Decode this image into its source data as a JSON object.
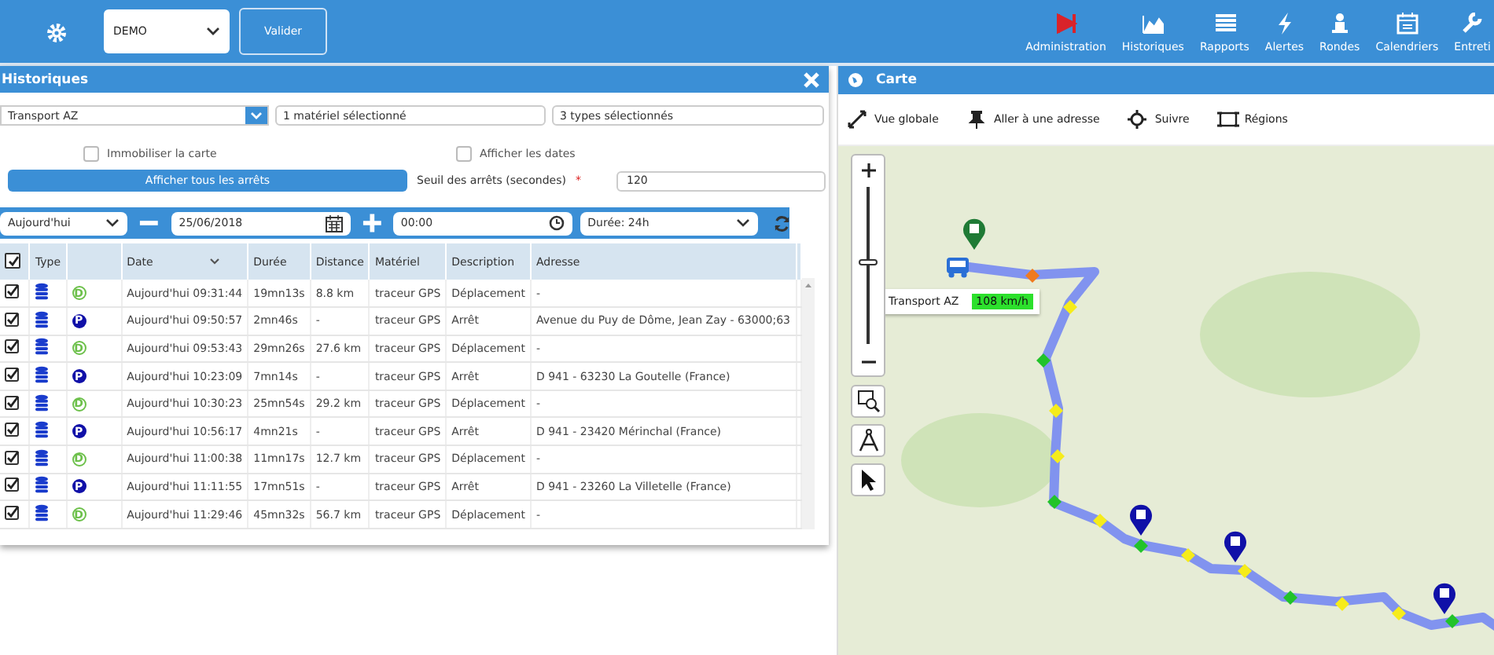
{
  "topbar": {
    "account": {
      "value": "DEMO"
    },
    "validate_button": "Valider",
    "nav": [
      {
        "label": "Administration"
      },
      {
        "label": "Historiques"
      },
      {
        "label": "Rapports"
      },
      {
        "label": "Alertes"
      },
      {
        "label": "Rondes"
      },
      {
        "label": "Calendriers"
      },
      {
        "label": "Entreti"
      }
    ]
  },
  "history_panel": {
    "title": "Historiques",
    "vehicle_select": {
      "value": "Transport AZ"
    },
    "equipment_select": {
      "value": "1 matériel sélectionné"
    },
    "types_select": {
      "value": "3 types sélectionnés"
    },
    "options": [
      {
        "label": "Immobiliser la carte",
        "checked": false
      },
      {
        "label": "Afficher les dates",
        "checked": false
      }
    ],
    "show_all_button": "Afficher tous les arrêts",
    "threshold": {
      "label": "Seuil des arrêts (secondes)",
      "required_mark": "*",
      "value": "120"
    },
    "period": {
      "value": "Aujourd'hui"
    },
    "date": {
      "value": "25/06/2018"
    },
    "time": {
      "value": "00:00"
    },
    "duration": {
      "value": "Durée: 24h"
    },
    "table": {
      "all_checked": true,
      "columns": [
        "Type",
        "Date",
        "Durée",
        "Distance",
        "Matériel",
        "Description",
        "Adresse"
      ],
      "rows": [
        {
          "checked": true,
          "kind": "move",
          "badge": "D",
          "date": "Aujourd'hui 09:31:44",
          "duree": "19mn13s",
          "distance": "8.8 km",
          "materiel": "traceur GPS",
          "description": "Déplacement",
          "adresse": "-"
        },
        {
          "checked": true,
          "kind": "stop",
          "badge": "P",
          "date": "Aujourd'hui 09:50:57",
          "duree": "2mn46s",
          "distance": "-",
          "materiel": "traceur GPS",
          "description": "Arrêt",
          "adresse": "Avenue du Puy de Dôme, Jean Zay - 63000;63"
        },
        {
          "checked": true,
          "kind": "move",
          "badge": "D",
          "date": "Aujourd'hui 09:53:43",
          "duree": "29mn26s",
          "distance": "27.6 km",
          "materiel": "traceur GPS",
          "description": "Déplacement",
          "adresse": "-"
        },
        {
          "checked": true,
          "kind": "stop",
          "badge": "P",
          "date": "Aujourd'hui 10:23:09",
          "duree": "7mn14s",
          "distance": "-",
          "materiel": "traceur GPS",
          "description": "Arrêt",
          "adresse": "D 941 - 63230 La Goutelle (France)"
        },
        {
          "checked": true,
          "kind": "move",
          "badge": "D",
          "date": "Aujourd'hui 10:30:23",
          "duree": "25mn54s",
          "distance": "29.2 km",
          "materiel": "traceur GPS",
          "description": "Déplacement",
          "adresse": "-"
        },
        {
          "checked": true,
          "kind": "stop",
          "badge": "P",
          "date": "Aujourd'hui 10:56:17",
          "duree": "4mn21s",
          "distance": "-",
          "materiel": "traceur GPS",
          "description": "Arrêt",
          "adresse": "D 941 - 23420 Mérinchal (France)"
        },
        {
          "checked": true,
          "kind": "move",
          "badge": "D",
          "date": "Aujourd'hui 11:00:38",
          "duree": "11mn17s",
          "distance": "12.7 km",
          "materiel": "traceur GPS",
          "description": "Déplacement",
          "adresse": "-"
        },
        {
          "checked": true,
          "kind": "stop",
          "badge": "P",
          "date": "Aujourd'hui 11:11:55",
          "duree": "17mn51s",
          "distance": "-",
          "materiel": "traceur GPS",
          "description": "Arrêt",
          "adresse": "D 941 - 23260 La Villetelle (France)"
        },
        {
          "checked": true,
          "kind": "move",
          "badge": "D",
          "date": "Aujourd'hui 11:29:46",
          "duree": "45mn32s",
          "distance": "56.7 km",
          "materiel": "traceur GPS",
          "description": "Déplacement",
          "adresse": "-"
        }
      ]
    }
  },
  "map_panel": {
    "title": "Carte",
    "tools": [
      {
        "label": "Vue globale"
      },
      {
        "label": "Aller à une adresse"
      },
      {
        "label": "Suivre"
      },
      {
        "label": "Régions"
      }
    ],
    "zoom": {
      "level": 0.5
    },
    "vehicle_label": {
      "name": "Transport AZ",
      "speed": "108 km/h"
    }
  }
}
